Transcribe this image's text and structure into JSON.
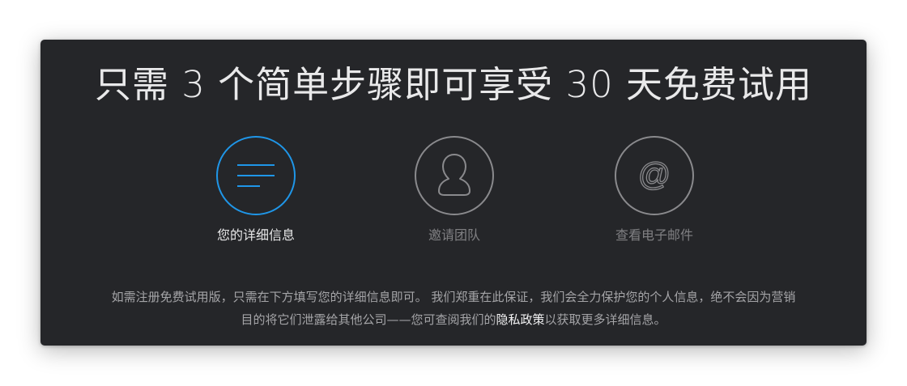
{
  "dialog": {
    "title": "只需 3 个简单步骤即可享受 30 天免费试用",
    "steps": [
      {
        "label": "您的详细信息",
        "icon": "lines-icon",
        "active": true
      },
      {
        "label": "邀请团队",
        "icon": "person-icon",
        "active": false
      },
      {
        "label": "查看电子邮件",
        "icon": "at-icon",
        "active": false
      }
    ],
    "description": {
      "line1": "如需注册免费试用版，只需在下方填写您的详细信息即可。 我们郑重在此保证，我们会全力保护您的个人信息，绝不会因为营销",
      "line2_before": "目的将它们泄露给其他公司——您可查阅我们的",
      "link": "隐私政策",
      "line2_after": "以获取更多详细信息。"
    }
  },
  "colors": {
    "background": "#252629",
    "active_accent": "#1f96e8",
    "inactive_stroke": "#8a8a8d",
    "title_text": "#e9e9ea"
  }
}
